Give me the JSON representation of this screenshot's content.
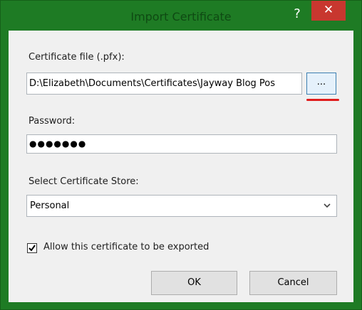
{
  "window": {
    "title": "Import Certificate",
    "help_glyph": "?",
    "close_glyph": "✕"
  },
  "form": {
    "certificate_file_label": "Certificate file (.pfx):",
    "certificate_file_value": "D:\\Elizabeth\\Documents\\Certificates\\Jayway Blog Pos",
    "browse_label": "...",
    "password_label": "Password:",
    "password_value": "●●●●●●●",
    "store_label": "Select Certificate Store:",
    "store_selected": "Personal",
    "allow_export_label": "Allow this certificate to be exported",
    "allow_export_checked": true
  },
  "buttons": {
    "ok_label": "OK",
    "cancel_label": "Cancel"
  },
  "colors": {
    "titlebar": "#1e7b24",
    "close_button": "#c8372f",
    "annotation_underline": "#e01c1c"
  },
  "icons": [
    "help-icon",
    "close-icon",
    "chevron-down-icon",
    "checkmark-icon"
  ]
}
